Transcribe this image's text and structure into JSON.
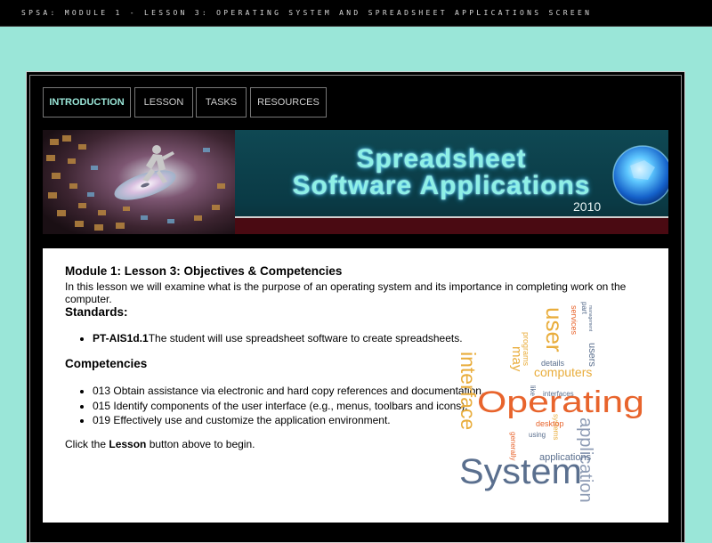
{
  "page": {
    "title": "SPSA: MODULE 1 - LESSON 3: OPERATING SYSTEM AND SPREADSHEET APPLICATIONS SCREEN"
  },
  "nav": {
    "items": [
      {
        "label": "INTRODUCTION",
        "active": true
      },
      {
        "label": "LESSON",
        "active": false
      },
      {
        "label": "TASKS",
        "active": false
      },
      {
        "label": "RESOURCES",
        "active": false
      }
    ]
  },
  "banner": {
    "title_line1": "Spreadsheet",
    "title_line2": "Software Applications",
    "year": "2010"
  },
  "content": {
    "heading": "Module 1: Lesson 3: Objectives & Competencies",
    "intro": "In this lesson we will examine what is the purpose of an operating system and its importance in completing work on the computer.",
    "standards_heading": "Standards:",
    "standards": [
      {
        "code": "PT-AIS1d.1",
        "text": "The student will use spreadsheet software to create spreadsheets."
      }
    ],
    "competencies_heading": "Competencies",
    "competencies": [
      "013 Obtain assistance via electronic and hard copy references and documentation.",
      "015 Identify components of the user interface (e.g., menus, toolbars and icons).",
      "019 Effectively use and customize the application environment."
    ],
    "click_prefix": "Click the ",
    "click_bold": "Lesson",
    "click_suffix": " button above to begin."
  },
  "wordcloud": {
    "words": [
      {
        "text": "Operating",
        "color": "#e8642c"
      },
      {
        "text": "System",
        "color": "#5a6f8e"
      },
      {
        "text": "interface",
        "color": "#e9ad3c"
      },
      {
        "text": "application",
        "color": "#8d9bb4"
      },
      {
        "text": "user",
        "color": "#e9ad3c"
      },
      {
        "text": "computers",
        "color": "#e9ad3c"
      },
      {
        "text": "applications",
        "color": "#5a6f8e"
      },
      {
        "text": "desktop",
        "color": "#e8642c"
      },
      {
        "text": "interfaces",
        "color": "#5a6f8e"
      },
      {
        "text": "may",
        "color": "#e9ad3c"
      },
      {
        "text": "details",
        "color": "#5a6f8e"
      },
      {
        "text": "programs",
        "color": "#e9ad3c"
      },
      {
        "text": "generally",
        "color": "#e8642c"
      },
      {
        "text": "services",
        "color": "#e8642c"
      },
      {
        "text": "using",
        "color": "#5a6f8e"
      },
      {
        "text": "systems",
        "color": "#e9ad3c"
      },
      {
        "text": "like",
        "color": "#5a6f8e"
      },
      {
        "text": "users",
        "color": "#5a6f8e"
      },
      {
        "text": "part",
        "color": "#5a6f8e"
      },
      {
        "text": "management",
        "color": "#5a6f8e"
      }
    ]
  },
  "colors": {
    "page_bg": "#9ae6d8",
    "frame_bg": "#000000",
    "nav_active": "#9ae6d8",
    "nav_text": "#cfcfcf"
  }
}
